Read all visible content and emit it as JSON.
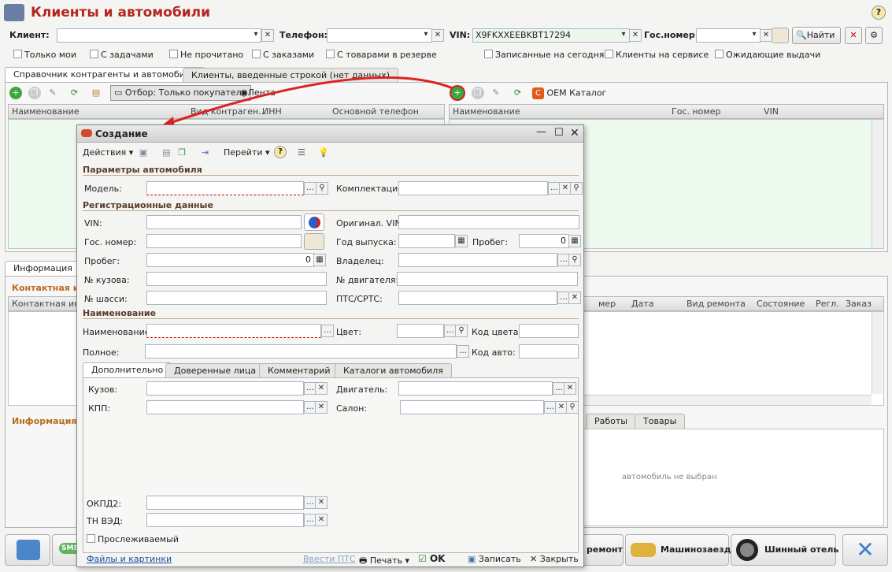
{
  "window": {
    "title": "Клиенты и автомобили",
    "help": "?"
  },
  "filters": {
    "client_label": "Клиент:",
    "phone_label": "Телефон:",
    "vin_label": "VIN:",
    "vin_value": "X9FKXXEEBKBT17294",
    "gos_label": "Гос.номер:",
    "search_button": "Найти",
    "checks": [
      "Только мои",
      "С задачами",
      "Не прочитано",
      "С заказами",
      "С товарами в резерве",
      "Записанные на сегодня",
      "Клиенты на сервисе",
      "Ожидающие выдачи"
    ]
  },
  "tabs_top": [
    "Справочник контрагенты и автомобили",
    "Клиенты, введенные строкой (нет данных)"
  ],
  "left_toolbar": {
    "filter_button": "Отбор: Только покупатели",
    "feed_button": "Лента"
  },
  "right_toolbar": {
    "oem_button": "OEM Каталог"
  },
  "left_grid_headers": [
    "Наименование",
    "Вид контраген...",
    "ИНН",
    "Основной телефон"
  ],
  "right_grid_headers": [
    "Наименование",
    "Гос. номер",
    "VIN"
  ],
  "lower_tabs": [
    "Информация"
  ],
  "lower_left": {
    "contact_section": "Контактная ин",
    "contact_header": "Контактная инф",
    "info_section": "Информация с"
  },
  "lower_right_headers": [
    "мер",
    "Дата",
    "Вид ремонта",
    "Состояние",
    "Регл.",
    "Заказ"
  ],
  "lower_right_tabs": [
    "Работы",
    "Товары"
  ],
  "no_car_text": "автомобиль не выбран",
  "bottom_buttons": {
    "sms": "SMS",
    "repair": "ремонт",
    "car_entry": "Машинозаезд",
    "tire_hotel": "Шинный отель"
  },
  "dialog": {
    "title": "Создание",
    "toolbar": {
      "actions": "Действия",
      "goto": "Перейти",
      "help": "?"
    },
    "sections": {
      "car_params": "Параметры автомобиля",
      "reg_data": "Регистрационные данные",
      "naming": "Наименование"
    },
    "fields": {
      "model": "Модель:",
      "equipment": "Комплектация:",
      "vin": "VIN:",
      "orig_vin": "Оригинал. VIN:",
      "gos_nomer": "Гос. номер:",
      "year": "Год выпуска:",
      "mileage1": "Пробег:",
      "mileage1_value": "0",
      "mileage2": "Пробег:",
      "mileage2_value": "0",
      "owner": "Владелец:",
      "body_no": "№ кузова:",
      "engine_no": "№ двигателя:",
      "chassis_no": "№ шасси:",
      "pts": "ПТС/СРТС:",
      "name": "Наименование:",
      "color": "Цвет:",
      "color_code": "Код цвета:",
      "full": "Полное:",
      "car_code": "Код авто:"
    },
    "tabs": [
      "Дополнительно",
      "Доверенные лица",
      "Комментарий",
      "Каталоги автомобиля"
    ],
    "extra": {
      "body": "Кузов:",
      "engine": "Двигатель:",
      "gearbox": "КПП:",
      "salon": "Салон:",
      "okpd": "ОКПД2:",
      "tnved": "ТН ВЭД:",
      "tracked": "Прослеживаемый"
    },
    "footer": {
      "files": "Файлы и картинки",
      "enter_pts": "Ввести ПТС",
      "print": "Печать",
      "ok": "OK",
      "save": "Записать",
      "close": "Закрыть"
    }
  }
}
